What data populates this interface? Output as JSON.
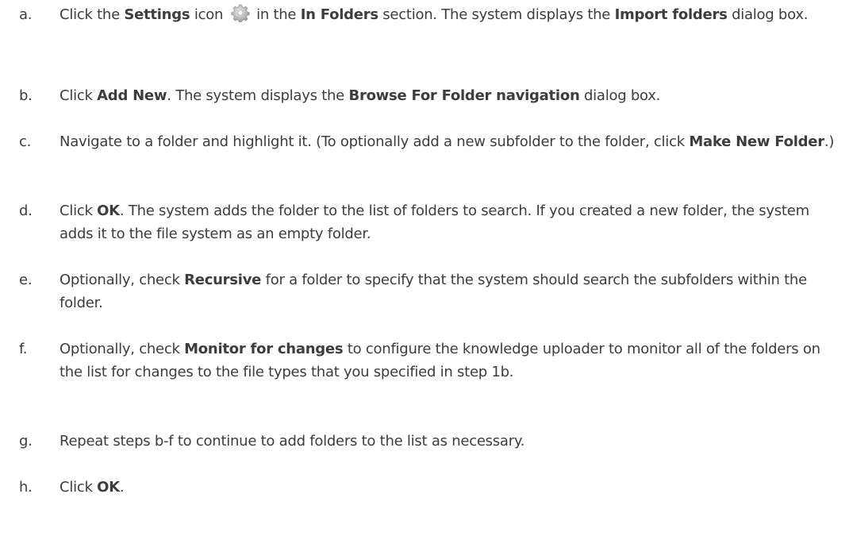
{
  "steps": [
    {
      "marker": "a.",
      "parts": [
        {
          "t": "Click the "
        },
        {
          "t": "Settings",
          "b": true
        },
        {
          "t": " icon "
        },
        {
          "icon": "settings-gear-icon"
        },
        {
          "t": " in the "
        },
        {
          "t": "In Folders",
          "b": true
        },
        {
          "t": " section. The system displays the "
        },
        {
          "t": "Import folders",
          "b": true
        },
        {
          "t": " dialog box."
        }
      ]
    },
    {
      "marker": "b.",
      "parts": [
        {
          "t": "Click "
        },
        {
          "t": "Add New",
          "b": true
        },
        {
          "t": ". The system displays the "
        },
        {
          "t": "Browse For Folder navigation",
          "b": true
        },
        {
          "t": " dialog box."
        }
      ]
    },
    {
      "marker": "c.",
      "parts": [
        {
          "t": "Navigate to a folder and highlight it. (To optionally add a new subfolder to the folder, click "
        },
        {
          "t": "Make New Folder",
          "b": true
        },
        {
          "t": ".)"
        }
      ]
    },
    {
      "marker": "d.",
      "parts": [
        {
          "t": "Click "
        },
        {
          "t": "OK",
          "b": true
        },
        {
          "t": ". The system adds the folder to the list of folders to search. If you created a new folder, the system adds it to the file system as an empty folder."
        }
      ]
    },
    {
      "marker": "e.",
      "parts": [
        {
          "t": "Optionally, check "
        },
        {
          "t": "Recursive",
          "b": true
        },
        {
          "t": " for a folder to specify that the system should search the subfolders within the folder."
        }
      ]
    },
    {
      "marker": "f.",
      "parts": [
        {
          "t": "Optionally, check "
        },
        {
          "t": "Monitor for changes",
          "b": true
        },
        {
          "t": " to configure the knowledge uploader to monitor all of the folders on the list for changes to the file types that you specified in step 1b."
        }
      ]
    },
    {
      "marker": "g.",
      "parts": [
        {
          "t": "Repeat steps b-f to continue to add folders to the list as necessary."
        }
      ]
    },
    {
      "marker": "h.",
      "parts": [
        {
          "t": "Click "
        },
        {
          "t": "OK",
          "b": true
        },
        {
          "t": "."
        }
      ]
    }
  ]
}
